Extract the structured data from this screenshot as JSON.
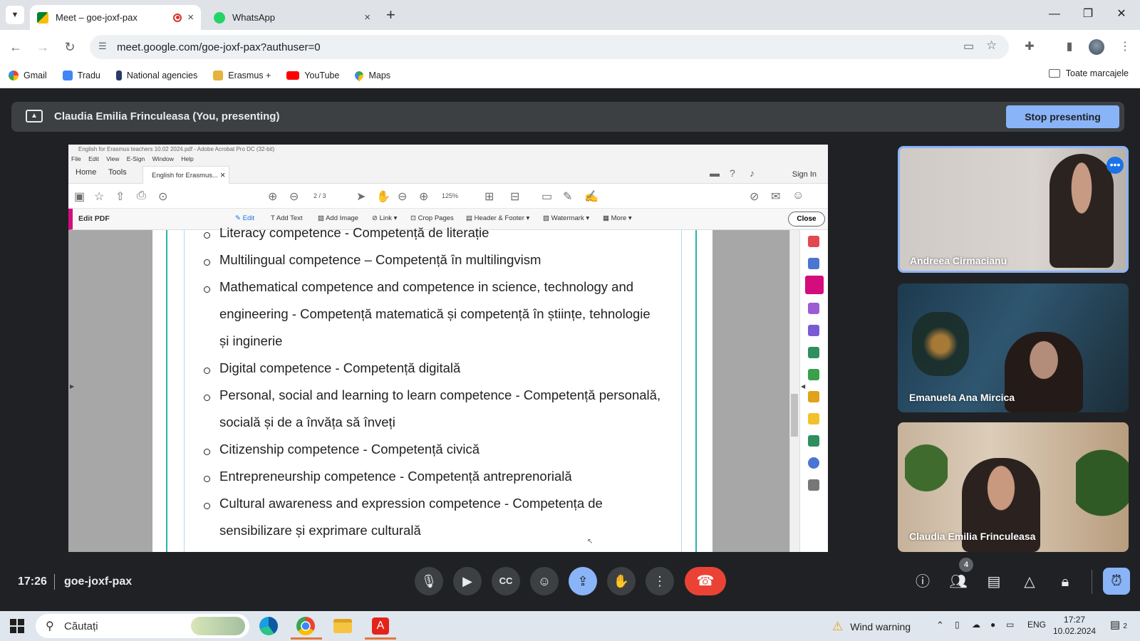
{
  "browser": {
    "tabs": [
      {
        "title": "Meet – goe-joxf-pax",
        "close": "×"
      },
      {
        "title": "WhatsApp",
        "close": "×"
      }
    ],
    "new_tab": "+",
    "url": "meet.google.com/goe-joxf-pax?authuser=0",
    "bookmarks": [
      "Gmail",
      "Tradu",
      "National agencies",
      "Erasmus +",
      "YouTube",
      "Maps"
    ],
    "all_bookmarks": "Toate marcajele"
  },
  "meet": {
    "presenting_label": "Claudia Emilia Frinculeasa (You, presenting)",
    "stop_presenting": "Stop presenting",
    "time": "17:26",
    "meeting_code": "goe-joxf-pax",
    "participant_count": "4",
    "participants": [
      "Andreea Cirmacianu",
      "Emanuela Ana Mircica",
      "Claudia Emilia Frinculeasa"
    ]
  },
  "acrobat": {
    "window_title": "English for Erasmus teachers 10.02 2024.pdf - Adobe Acrobat Pro DC (32-bit)",
    "menu": [
      "File",
      "Edit",
      "View",
      "E-Sign",
      "Window",
      "Help"
    ],
    "tabs": [
      "Home",
      "Tools"
    ],
    "doc_tab": "English for Erasmus...",
    "sign_in": "Sign In",
    "page_indicator": "2 / 3",
    "zoom": "125%",
    "edit_label": "Edit PDF",
    "edit_tools": [
      "Edit",
      "Add Text",
      "Add Image",
      "Link",
      "Crop Pages",
      "Header & Footer",
      "Watermark",
      "More"
    ],
    "close": "Close"
  },
  "document": {
    "lines": [
      "Literacy competence - Competență de literație",
      "Multilingual competence – Competență în multilingvism",
      "Mathematical competence and competence in science, technology and",
      "engineering - Competență matematică și competență în științe, tehnologie",
      "și inginerie",
      "Digital competence - Competență digitală",
      "Personal, social and learning to learn competence - Competență personală,",
      "socială și de a învăța să înveți",
      "Citizenship competence - Competență civică",
      "Entrepreneurship competence - Competență antreprenorială",
      "Cultural awareness and expression competence - Competența de",
      "sensibilizare și exprimare culturală"
    ]
  },
  "taskbar": {
    "search_placeholder": "Căutați",
    "weather": "Wind warning",
    "language": "ENG",
    "time": "17:27",
    "date": "10.02.2024",
    "notifications": "2"
  },
  "colors": {
    "meet_bg": "#202124",
    "stop_presenting": "#8ab4f8",
    "end_call": "#ea4335",
    "acrobat_edit_accent": "#d40d7d"
  }
}
